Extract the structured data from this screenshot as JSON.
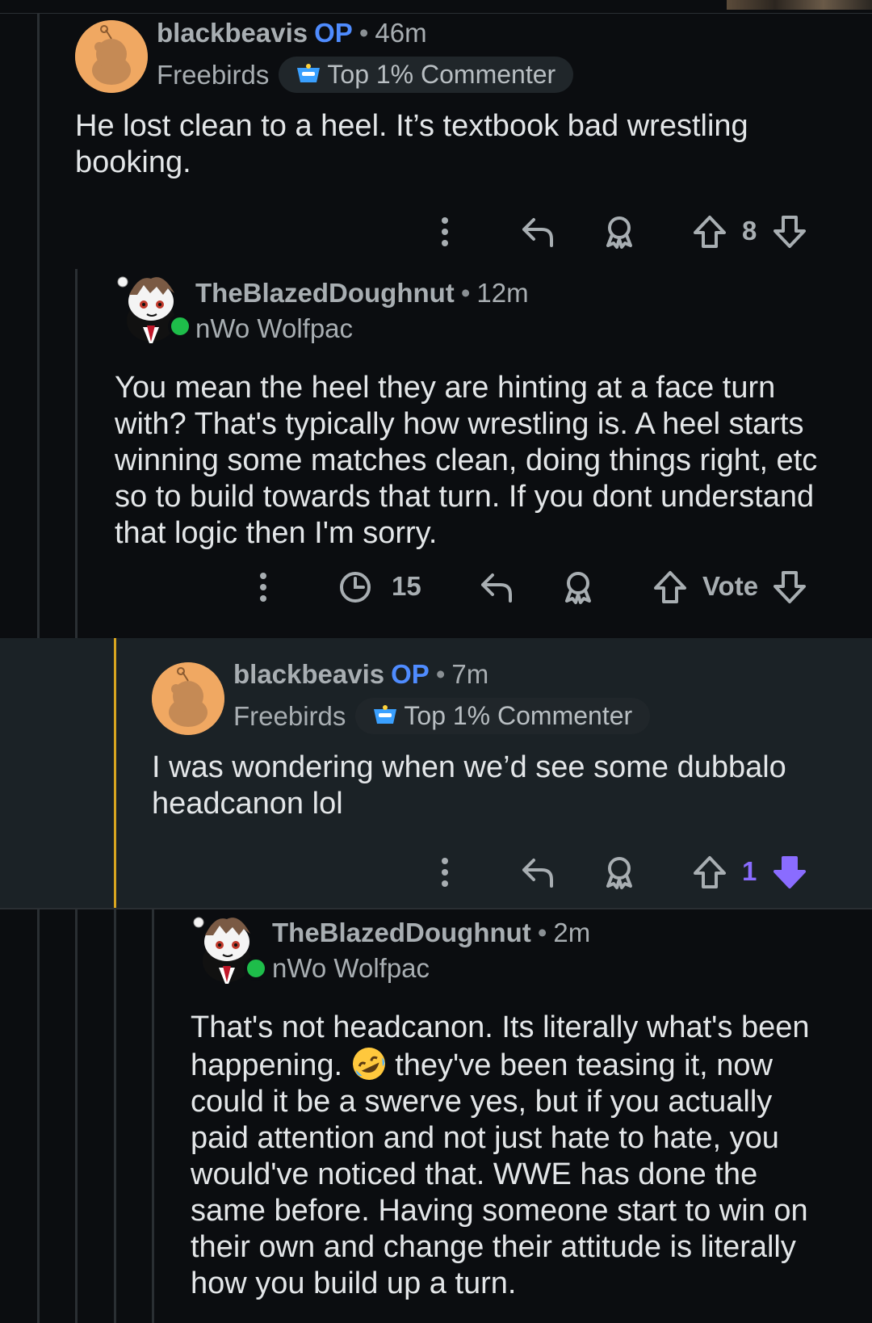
{
  "comments": [
    {
      "username": "blackbeavis",
      "op_label": "OP",
      "time": "46m",
      "flair": "Freebirds",
      "badge": "Top 1% Commenter",
      "body": "He lost clean to a heel. It’s textbook bad wrestling booking.",
      "vote_count": "8"
    },
    {
      "username": "TheBlazedDoughnut",
      "time": "12m",
      "flair": "nWo Wolfpac",
      "body": "You mean the heel they are hinting at a face turn with? That's typically how wrestling is. A heel starts winning some matches clean, doing things right, etc so to build towards that turn. If you dont understand that logic then I'm sorry.",
      "view_count": "15",
      "vote_label": "Vote"
    },
    {
      "username": "blackbeavis",
      "op_label": "OP",
      "time": "7m",
      "flair": "Freebirds",
      "badge": "Top 1% Commenter",
      "body": "I was wondering when we’d see some dubbalo headcanon lol",
      "vote_count": "1"
    },
    {
      "username": "TheBlazedDoughnut",
      "time": "2m",
      "flair": "nWo Wolfpac",
      "body_before_emoji": "That's not headcanon. Its literally what's been happening. ",
      "emoji_name": "rolling-on-floor-laughing",
      "body_after_emoji": " they've been teasing it, now could it be a swerve yes, but if you actually paid attention and not just hate to hate, you would've noticed that. WWE has done the same before. Having someone start to win on their own and change their attitude is literally how you build up a turn."
    }
  ],
  "colors": {
    "background": "#0b0d10",
    "highlight": "#1b2226",
    "accent": "#d9a620",
    "op": "#4f8cff",
    "downvote_active": "#8a6cff"
  },
  "icons": [
    "more-options-icon",
    "reply-icon",
    "award-icon",
    "upvote-icon",
    "downvote-icon",
    "views-clock-icon"
  ]
}
